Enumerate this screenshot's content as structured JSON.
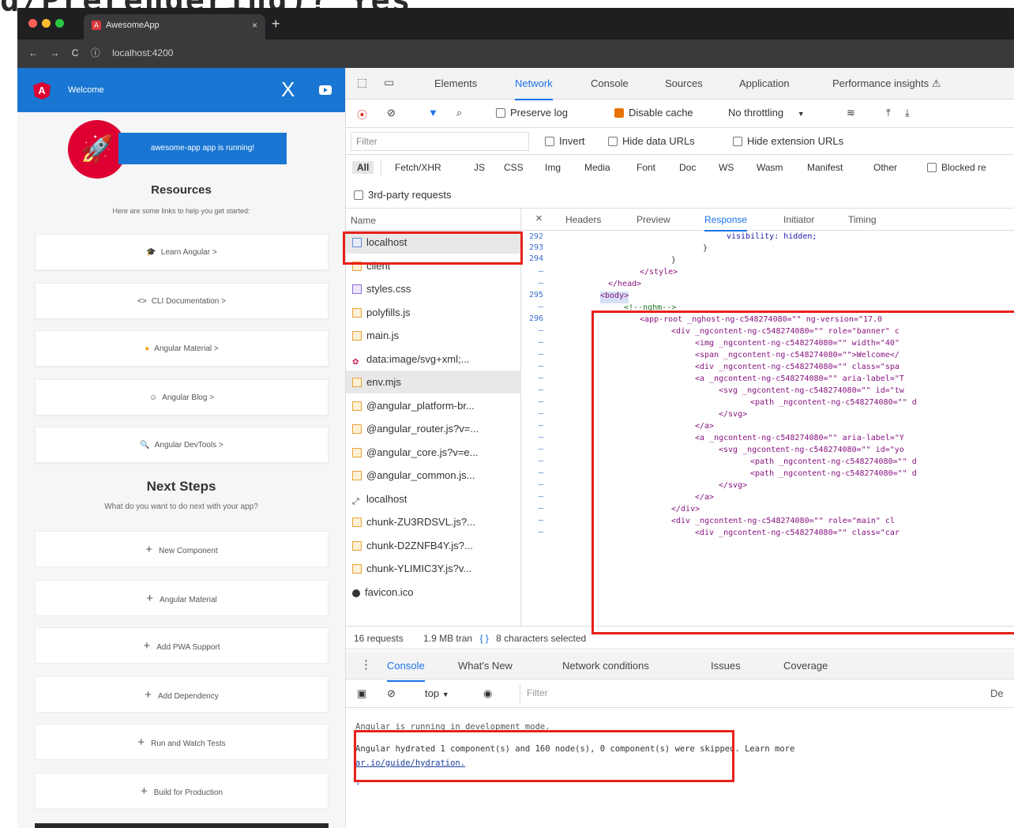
{
  "background": {
    "title_fragment": "g/Prerendering)? Yes"
  },
  "browser": {
    "tab_title": "AwesomeApp",
    "tab_close": "×",
    "new_tab": "+",
    "address": "localhost:4200",
    "nav": {
      "back": "←",
      "forward": "→",
      "reload": "C",
      "site_info": "ⓘ"
    }
  },
  "app": {
    "logo": "A",
    "header_title": "Welcome",
    "close_glyph": "X",
    "running_text": "awesome-app app is running!",
    "resources_title": "Resources",
    "resources_subtitle": "Here are some links to help you get started:",
    "resources": [
      {
        "icon": "🎓",
        "label": "Learn Angular >"
      },
      {
        "icon": "<>",
        "label": "CLI Documentation >"
      },
      {
        "icon": "●",
        "label": "Angular Material >"
      },
      {
        "icon": "☺",
        "label": "Angular Blog >"
      },
      {
        "icon": "🔍",
        "label": "Angular DevTools >"
      }
    ],
    "next_title": "Next Steps",
    "next_subtitle": "What do you want to do next with your app?",
    "steps": [
      {
        "label": "New Component"
      },
      {
        "label": "Angular Material"
      },
      {
        "label": "Add PWA Support"
      },
      {
        "label": "Add Dependency"
      },
      {
        "label": "Run and Watch Tests"
      },
      {
        "label": "Build for Production"
      }
    ],
    "plus_glyph": "+"
  },
  "devtools": {
    "panels": [
      "Elements",
      "Network",
      "Console",
      "Sources",
      "Application",
      "Performance insights ⚠"
    ],
    "active_panel": "Network",
    "toolbar": {
      "preserve_log": "Preserve log",
      "disable_cache": "Disable cache",
      "throttling": "No throttling",
      "caret": "▼"
    },
    "filter": {
      "placeholder": "Filter",
      "invert": "Invert",
      "hide_data_urls": "Hide data URLs",
      "hide_extension_urls": "Hide extension URLs"
    },
    "types": [
      "All",
      "Fetch/XHR",
      "JS",
      "CSS",
      "Img",
      "Media",
      "Font",
      "Doc",
      "WS",
      "Wasm",
      "Manifest",
      "Other"
    ],
    "blocked_label": "Blocked re",
    "third_party": "3rd-party requests",
    "name_header": "Name",
    "requests": [
      {
        "name": "localhost",
        "kind": "doc"
      },
      {
        "name": "client",
        "kind": "js"
      },
      {
        "name": "styles.css",
        "kind": "css"
      },
      {
        "name": "polyfills.js",
        "kind": "js"
      },
      {
        "name": "main.js",
        "kind": "js"
      },
      {
        "name": "data:image/svg+xml;...",
        "kind": "img"
      },
      {
        "name": "env.mjs",
        "kind": "js"
      },
      {
        "name": "@angular_platform-br...",
        "kind": "js"
      },
      {
        "name": "@angular_router.js?v=...",
        "kind": "js"
      },
      {
        "name": "@angular_core.js?v=e...",
        "kind": "js"
      },
      {
        "name": "@angular_common.js...",
        "kind": "js"
      },
      {
        "name": "localhost",
        "kind": "ws"
      },
      {
        "name": "chunk-ZU3RDSVL.js?...",
        "kind": "js"
      },
      {
        "name": "chunk-D2ZNFB4Y.js?...",
        "kind": "js"
      },
      {
        "name": "chunk-YLIMIC3Y.js?v...",
        "kind": "js"
      },
      {
        "name": "favicon.ico",
        "kind": "fav"
      }
    ],
    "detail_tabs": [
      "×",
      "Headers",
      "Preview",
      "Response",
      "Initiator",
      "Timing"
    ],
    "active_detail": "Response",
    "line_numbers": [
      "292",
      "293",
      "294",
      "–",
      "–",
      "295",
      "–",
      "296",
      "–",
      "–",
      "–",
      "–",
      "–",
      "–",
      "–",
      "–",
      "–",
      "–",
      "–",
      "–",
      "–",
      "–",
      "–",
      "–",
      "–",
      "–"
    ],
    "code_lines": [
      "visibility: hidden;",
      "}",
      "}",
      "</style>",
      "</head>",
      "<body>",
      "<!--nghm-->",
      "<app-root _nghost-ng-c548274080=\"\" ng-version=\"17.0",
      "<div _ngcontent-ng-c548274080=\"\" role=\"banner\" c",
      "<img _ngcontent-ng-c548274080=\"\" width=\"40\"",
      "<span _ngcontent-ng-c548274080=\"\">Welcome</",
      "<div _ngcontent-ng-c548274080=\"\" class=\"spa",
      "<a _ngcontent-ng-c548274080=\"\" aria-label=\"T",
      "<svg _ngcontent-ng-c548274080=\"\" id=\"tw",
      "<path _ngcontent-ng-c548274080=\"\" d",
      "</svg>",
      "</a>",
      "<a _ngcontent-ng-c548274080=\"\" aria-label=\"Y",
      "<svg _ngcontent-ng-c548274080=\"\" id=\"yo",
      "<path _ngcontent-ng-c548274080=\"\" d",
      "<path _ngcontent-ng-c548274080=\"\" d",
      "</svg>",
      "</a>",
      "</div>",
      "<div _ngcontent-ng-c548274080=\"\" role=\"main\" cl",
      "<div _ngcontent-ng-c548274080=\"\" class=\"car"
    ],
    "status": {
      "requests": "16 requests",
      "transferred": "1.9 MB tran",
      "braces": "{ }",
      "selection": "8 characters selected"
    },
    "drawer_tabs": [
      "Console",
      "What's New",
      "Network conditions",
      "Issues",
      "Coverage"
    ],
    "active_drawer": "Console",
    "console": {
      "context": "top",
      "filter_placeholder": "Filter",
      "levels": "De",
      "msg1": "Angular is running in development mode.",
      "msg2": "Angular hydrated 1 component(s) and 160 node(s), 0 component(s) were skipped. Learn more",
      "msg2_link": "ar.io/guide/hydration.",
      "prompt": "›"
    }
  },
  "colors": {
    "angular_red": "#dd0031",
    "material_blue": "#1976d2",
    "devtools_blue": "#1a73e8",
    "annotation_red": "#e8201a"
  }
}
